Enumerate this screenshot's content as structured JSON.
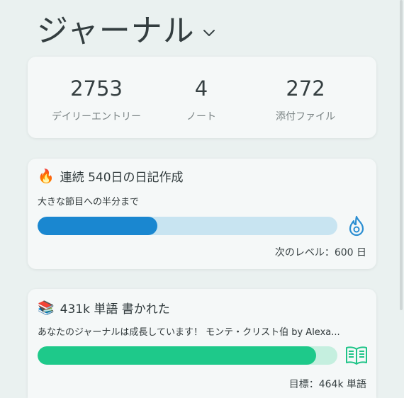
{
  "header": {
    "title": "ジャーナル"
  },
  "stats": [
    {
      "value": "2753",
      "label": "デイリーエントリー"
    },
    {
      "value": "4",
      "label": "ノート"
    },
    {
      "value": "272",
      "label": "添付ファイル"
    }
  ],
  "streak": {
    "emoji": "🔥",
    "title": "連続 540日の日記作成",
    "subtitle": "大きな節目への半分まで",
    "progress": 0.4,
    "footer": "次のレベル：600 日",
    "colors": {
      "fill": "#1a87d0",
      "track": "#c8e4f1",
      "icon": "#2b8ed2"
    }
  },
  "words": {
    "emoji": "📚",
    "title": "431k 単語 書かれた",
    "subtitle": "あなたのジャーナルは成長しています！ モンテ・クリスト伯 by Alexa...",
    "progress": 0.93,
    "footer": "目標：464k 単語",
    "colors": {
      "fill": "#1ec98a",
      "track": "#c5efdf",
      "icon": "#1fc488"
    }
  }
}
